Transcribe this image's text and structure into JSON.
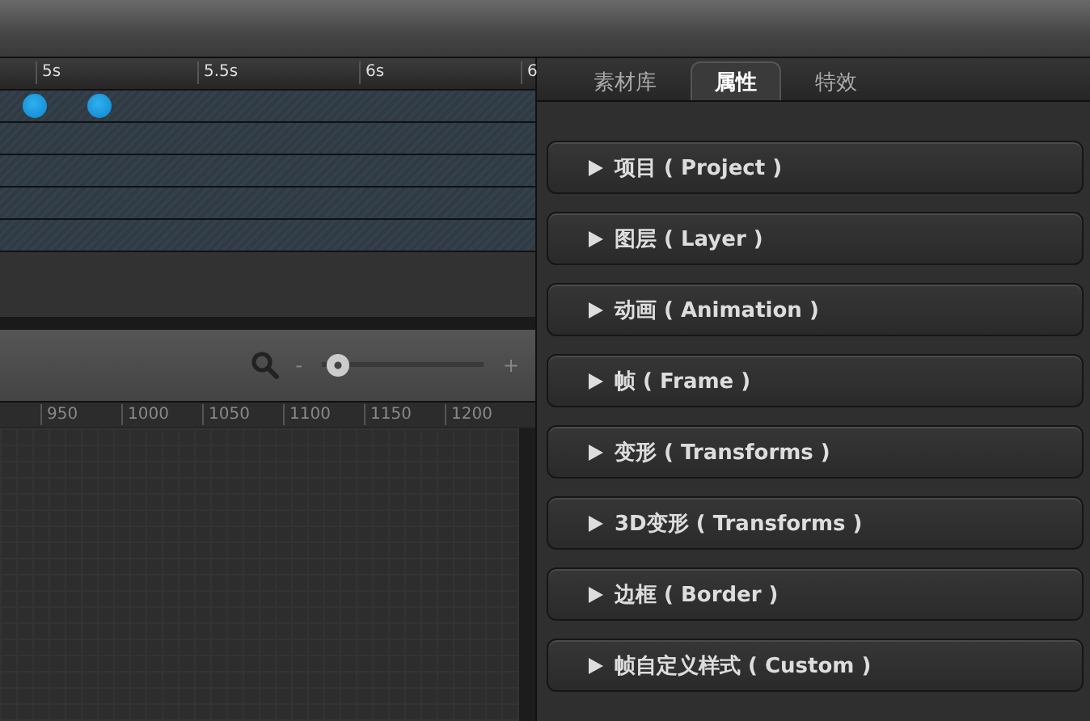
{
  "timeline": {
    "ticks": [
      "5s",
      "5.5s",
      "6s",
      "6"
    ],
    "tracks": [
      {
        "kind": "keyframed"
      },
      {
        "kind": "empty"
      },
      {
        "kind": "empty"
      },
      {
        "kind": "empty"
      },
      {
        "kind": "empty"
      }
    ]
  },
  "zoom": {
    "minus_label": "-",
    "plus_label": "+",
    "level": 0.03
  },
  "ruler": {
    "ticks": [
      "950",
      "1000",
      "1050",
      "1100",
      "1150",
      "1200"
    ]
  },
  "tabs": [
    {
      "label": "素材库",
      "selected": false
    },
    {
      "label": "属性",
      "selected": true
    },
    {
      "label": "特效",
      "selected": false
    }
  ],
  "sections": [
    {
      "label": "项目 ( Project )",
      "expanded": false
    },
    {
      "label": "图层 ( Layer )",
      "expanded": false
    },
    {
      "label": "动画 ( Animation )",
      "expanded": false
    },
    {
      "label": "帧 ( Frame )",
      "expanded": false
    },
    {
      "label": "变形 ( Transforms )",
      "expanded": false
    },
    {
      "label": "3D变形 ( Transforms )",
      "expanded": false
    },
    {
      "label": "边框 ( Border )",
      "expanded": false
    },
    {
      "label": "帧自定义样式 ( Custom )",
      "expanded": false
    }
  ]
}
